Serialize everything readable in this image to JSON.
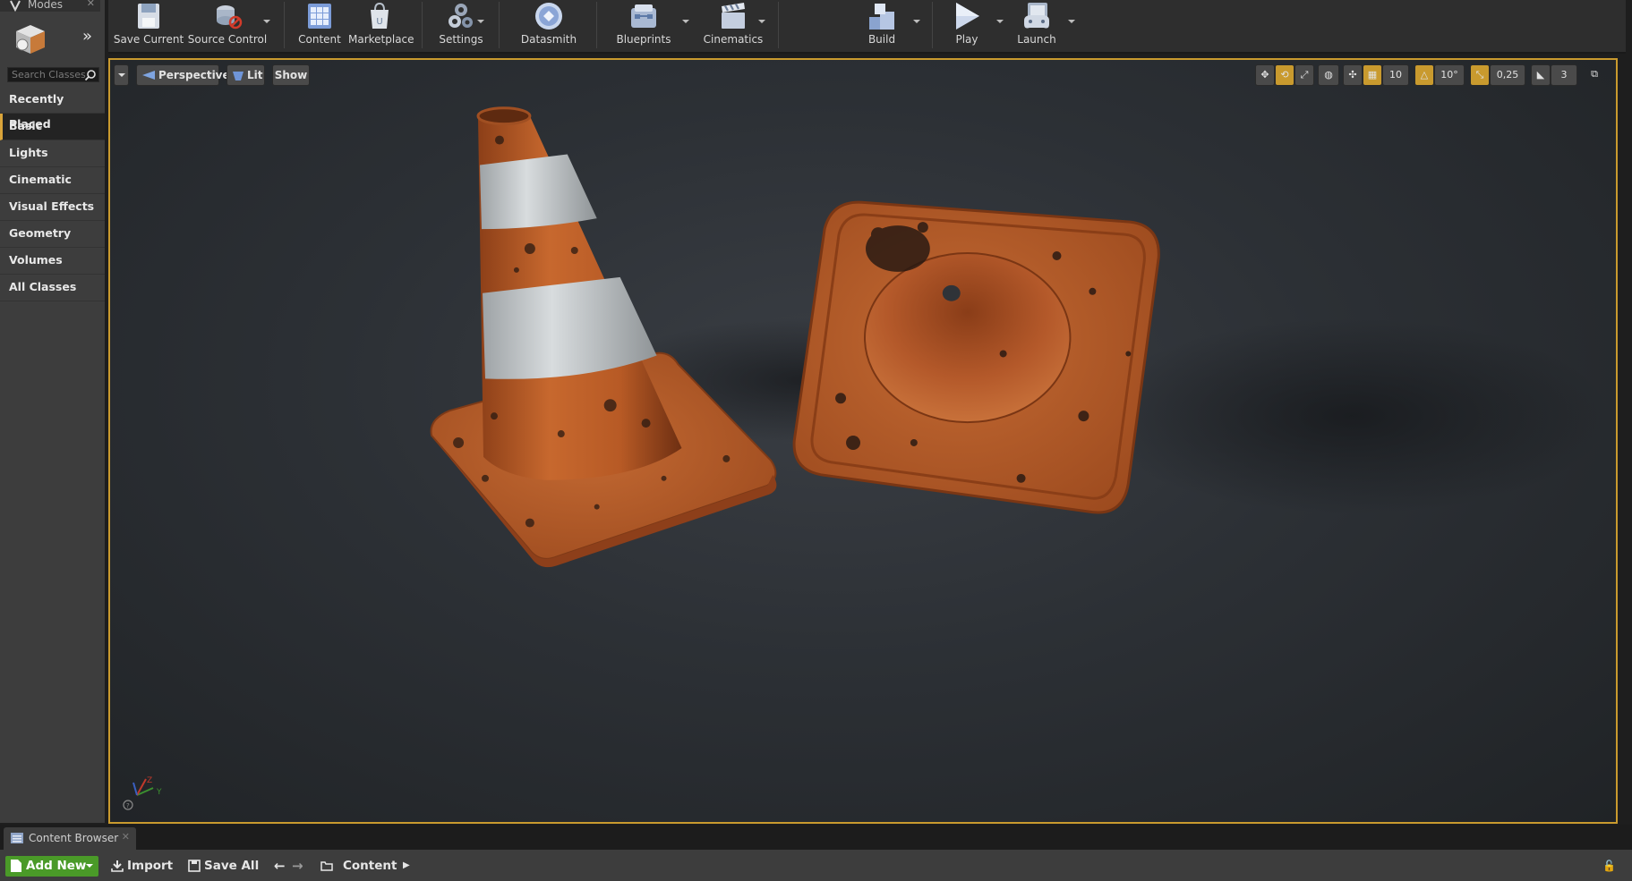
{
  "modes": {
    "tab_label": "Modes",
    "search_placeholder": "Search Classes",
    "categories": [
      {
        "label": "Recently Placed"
      },
      {
        "label": "Basic"
      },
      {
        "label": "Lights"
      },
      {
        "label": "Cinematic"
      },
      {
        "label": "Visual Effects"
      },
      {
        "label": "Geometry"
      },
      {
        "label": "Volumes"
      },
      {
        "label": "All Classes"
      }
    ],
    "selected_category": "Basic"
  },
  "toolbar": {
    "save_current": "Save Current",
    "source_control": "Source Control",
    "content": "Content",
    "marketplace": "Marketplace",
    "settings": "Settings",
    "datasmith": "Datasmith",
    "blueprints": "Blueprints",
    "cinematics": "Cinematics",
    "build": "Build",
    "play": "Play",
    "launch": "Launch"
  },
  "viewport": {
    "perspective": "Perspective",
    "lit": "Lit",
    "show": "Show",
    "grid_snap": "10",
    "rotation_snap": "10°",
    "scale_snap": "0,25",
    "camera_speed": "3"
  },
  "content_browser": {
    "tab_label": "Content Browser",
    "add_new": "Add New",
    "import": "Import",
    "save_all": "Save All",
    "path": "Content"
  },
  "colors": {
    "accent": "#c99a2e",
    "add_new_green": "#4a9a28",
    "cone_orange": "#b95a26",
    "stripe_white": "#c9cdcf"
  }
}
